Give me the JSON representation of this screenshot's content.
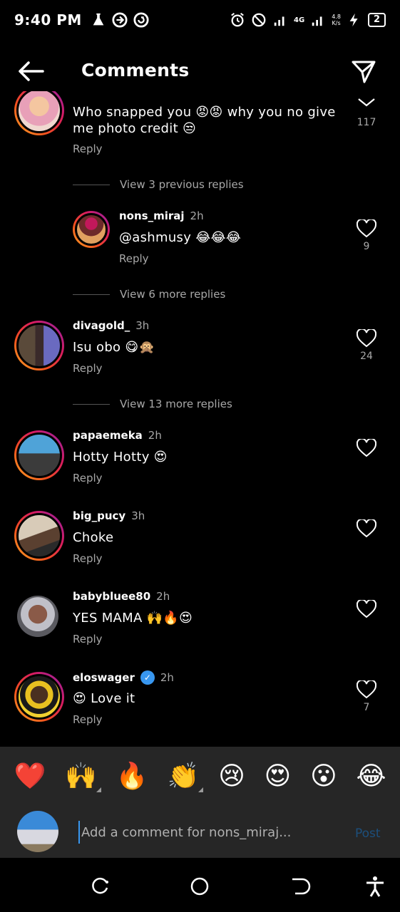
{
  "status": {
    "time": "9:40 PM",
    "network": "4G",
    "speed_value": "4.8",
    "speed_unit": "K/s",
    "battery": "2"
  },
  "header": {
    "title": "Comments"
  },
  "comments": [
    {
      "text": "Who snapped you 😡😡 why you no give me photo credit 😒",
      "reply": "Reply",
      "likes": "117"
    },
    {
      "view_replies": "View 3 previous replies"
    },
    {
      "username": "nons_miraj",
      "time": "2h",
      "text": "@ashmusy 😂😂😂",
      "reply": "Reply",
      "likes": "9"
    },
    {
      "view_replies": "View 6 more replies"
    },
    {
      "username": "divagold_",
      "time": "3h",
      "text": "Isu obo 😋🙊",
      "reply": "Reply",
      "likes": "24"
    },
    {
      "view_replies": "View 13 more replies"
    },
    {
      "username": "papaemeka",
      "time": "2h",
      "text": "Hotty Hotty 😍",
      "reply": "Reply",
      "likes": ""
    },
    {
      "username": "big_pucy",
      "time": "3h",
      "text": "Choke",
      "reply": "Reply",
      "likes": ""
    },
    {
      "username": "babybluee80",
      "time": "2h",
      "text": "YES MAMA 🙌🔥😍",
      "reply": "Reply",
      "likes": ""
    },
    {
      "username": "eloswager",
      "time": "2h",
      "text": "😍 Love it",
      "reply": "Reply",
      "likes": "7",
      "verified_mark": "✓"
    }
  ],
  "reactions": [
    "❤️",
    "🙌",
    "🔥",
    "👏",
    "😢",
    "😍",
    "😮",
    "😂"
  ],
  "input": {
    "placeholder": "Add a comment for nons_miraj...",
    "post_label": "Post"
  },
  "colors": {
    "background": "#000000",
    "panel": "#262626",
    "secondary_text": "#a8a8a8",
    "link_blue": "#3897f0"
  },
  "icons": [
    "back-arrow-icon",
    "send-icon",
    "heart-icon",
    "verified-badge-icon",
    "recent-apps-icon",
    "home-icon",
    "back-nav-icon",
    "accessibility-icon"
  ]
}
